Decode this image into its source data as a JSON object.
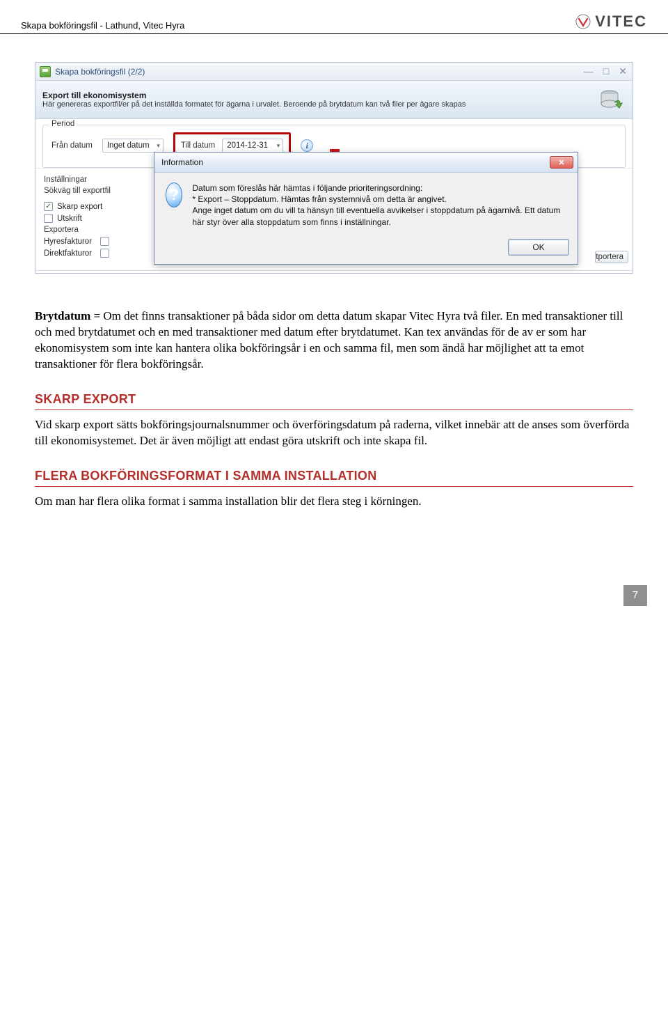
{
  "header": {
    "doc_title": "Skapa bokföringsfil - Lathund, Vitec Hyra",
    "brand_text": "VITEC"
  },
  "app": {
    "window_title": "Skapa bokföringsfil (2/2)",
    "section_heading": "Export till ekonomisystem",
    "section_sub": "Här genereras exportfil/er på det inställda formatet för ägarna i urvalet. Beroende på brytdatum kan två filer per ägare skapas",
    "period": {
      "legend": "Period",
      "from_label": "Från datum",
      "from_value": "Inget datum",
      "to_label": "Till datum",
      "to_value": "2014-12-31"
    },
    "settings": {
      "heading": "Inställningar",
      "sokvag": "Sökväg till exportfil",
      "chk_skarp": "Skarp export",
      "chk_utskrift": "Utskrift",
      "exportera_label": "Exportera",
      "hyresfakturor": "Hyresfakturor",
      "direktfakturor": "Direktfakturor",
      "hidden_btn_fragment": "tportera"
    },
    "modal": {
      "title": "Information",
      "body": "Datum som föreslås här hämtas i följande prioriteringsordning:\n* Export – Stoppdatum. Hämtas från systemnivå om detta är angivet.\nAnge inget datum om du vill ta hänsyn till eventuella avvikelser i stoppdatum på ägarnivå. Ett datum här styr över alla stoppdatum som finns i inställningar.",
      "ok": "OK"
    }
  },
  "doc": {
    "para1_bold": "Brytdatum",
    "para1": " = Om det finns transaktioner på båda sidor om detta datum skapar Vitec Hyra två filer. En med transaktioner till och med brytdatumet och en med transaktioner med datum efter brytdatumet. Kan tex användas för de av er som har ekonomisystem som inte kan hantera olika bokföringsår i en och samma fil, men som ändå har möjlighet att ta emot transaktioner för flera bokföringsår.",
    "h2": "SKARP EXPORT",
    "para2": "Vid skarp export sätts bokföringsjournalsnummer och överföringsdatum på raderna, vilket innebär att de anses som överförda till ekonomisystemet. Det är även möjligt att endast göra utskrift och inte skapa fil.",
    "h3": "FLERA BOKFÖRINGSFORMAT I SAMMA INSTALLATION",
    "para3": "Om man har flera olika format i samma installation blir det flera steg i körningen.",
    "page_number": "7"
  }
}
